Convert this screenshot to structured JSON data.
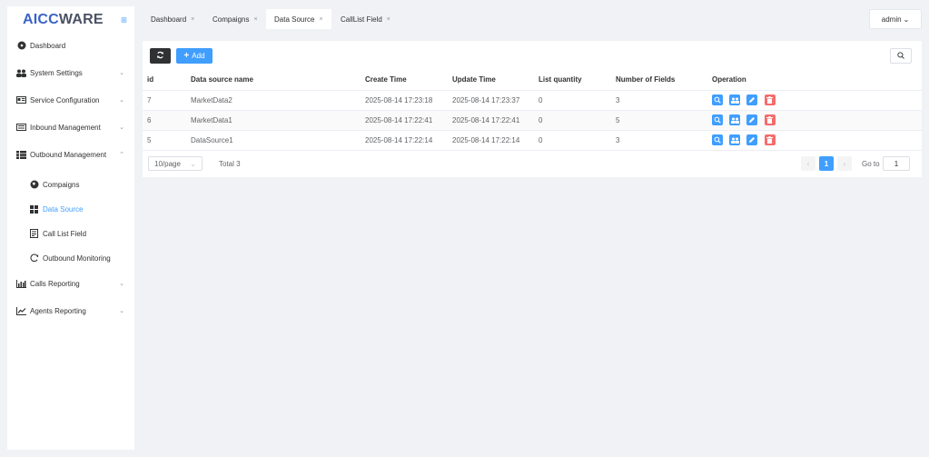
{
  "sidebar": {
    "logo_a": "AICC",
    "logo_b": "WARE",
    "items": [
      {
        "label": "Dashboard"
      },
      {
        "label": "System Settings"
      },
      {
        "label": "Service Configuration"
      },
      {
        "label": "Inbound Management"
      },
      {
        "label": "Outbound Management"
      },
      {
        "label": "Compaigns"
      },
      {
        "label": "Data Source"
      },
      {
        "label": "Call List Field"
      },
      {
        "label": "Outbound Monitoring"
      },
      {
        "label": "Calls Reporting"
      },
      {
        "label": "Agents Reporting"
      }
    ]
  },
  "tabs": [
    {
      "label": "Dashboard"
    },
    {
      "label": "Compaigns"
    },
    {
      "label": "Data Source"
    },
    {
      "label": "CallList Field"
    }
  ],
  "user": {
    "name": "admin"
  },
  "toolbar": {
    "add_label": "Add"
  },
  "table": {
    "columns": [
      "id",
      "Data source name",
      "Create Time",
      "Update Time",
      "List quantity",
      "Number of Fields",
      "Operation"
    ],
    "rows": [
      [
        "7",
        "MarketData2",
        "2025-08-14 17:23:18",
        "2025-08-14 17:23:37",
        "0",
        "3"
      ],
      [
        "6",
        "MarketData1",
        "2025-08-14 17:22:41",
        "2025-08-14 17:22:41",
        "0",
        "5"
      ],
      [
        "5",
        "DataSource1",
        "2025-08-14 17:22:14",
        "2025-08-14 17:22:14",
        "0",
        "3"
      ]
    ]
  },
  "pagination": {
    "page_size": "10/page",
    "total": "Total 3",
    "current_page": "1",
    "goto_label": "Go to",
    "goto_value": "1"
  },
  "colors": {
    "primary": "#409eff",
    "danger": "#f56c6c",
    "dark": "#303133"
  }
}
